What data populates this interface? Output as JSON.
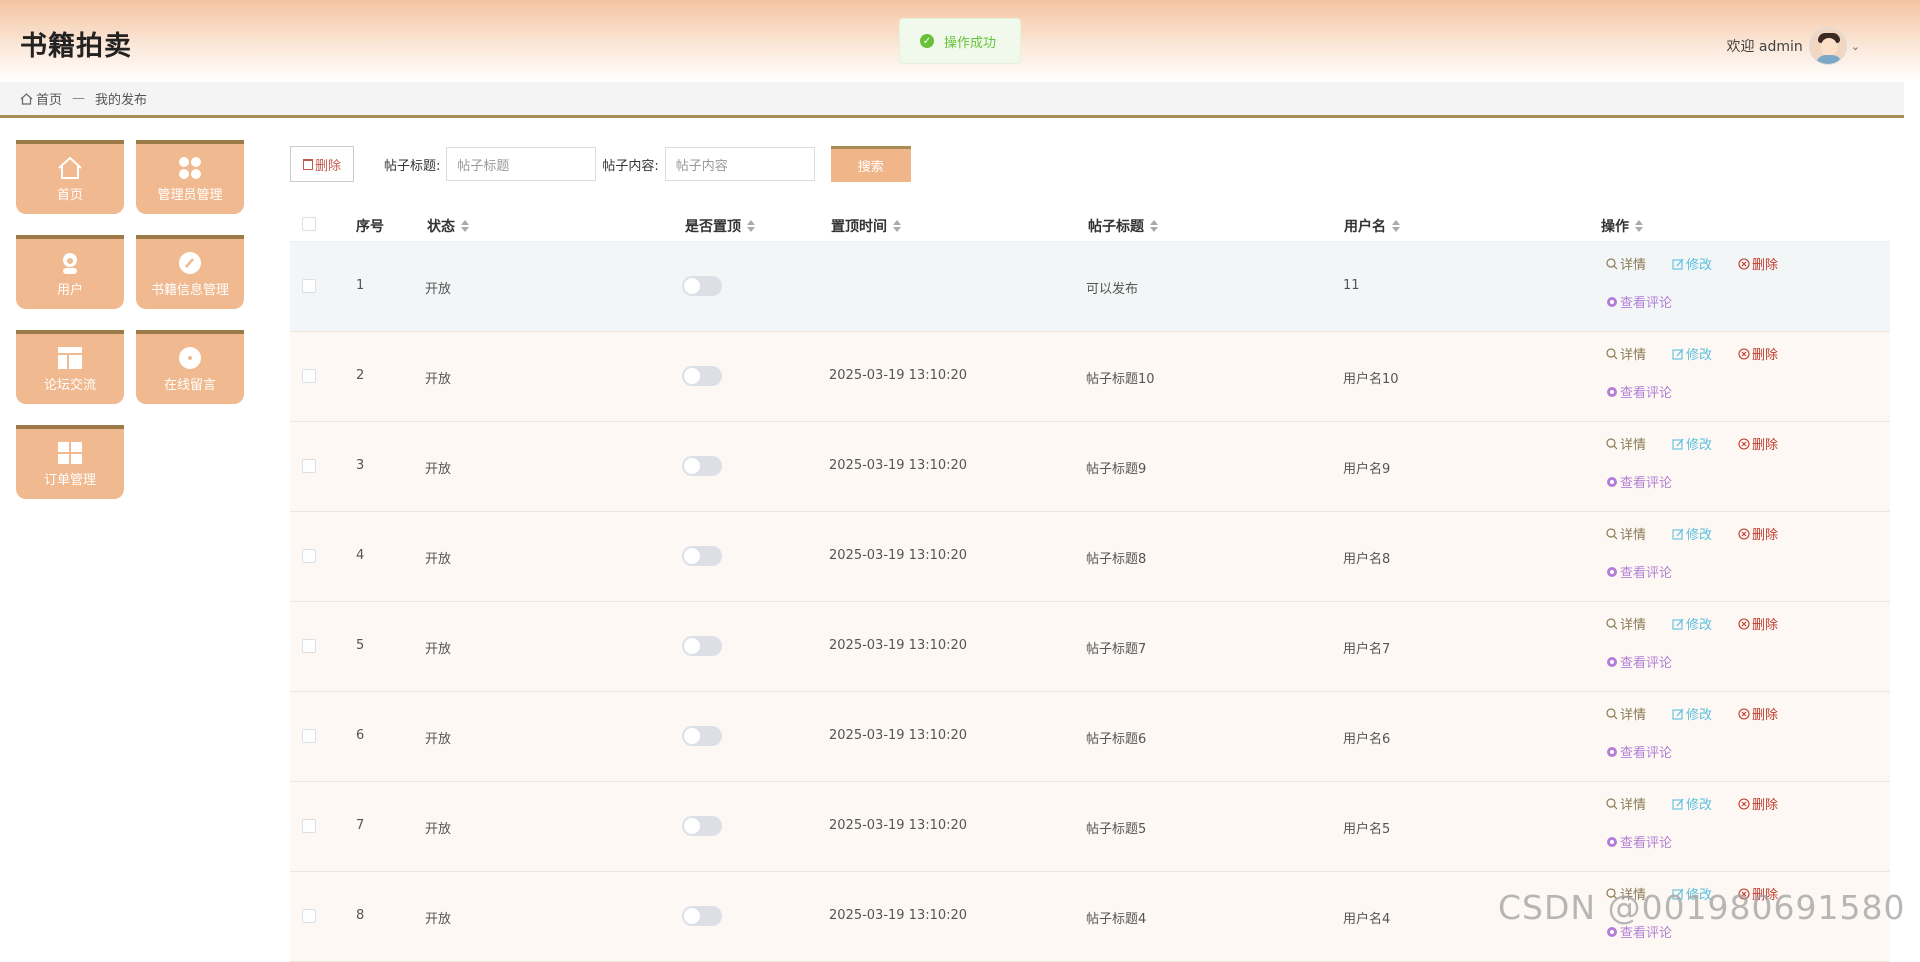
{
  "header": {
    "title": "书籍拍卖",
    "welcome": "欢迎 admin"
  },
  "toast": {
    "text": "操作成功"
  },
  "breadcrumb": {
    "home": "首页",
    "separator": "—",
    "current": "我的发布"
  },
  "sidebar": {
    "items": [
      {
        "label": "首页",
        "icon": "home-icon"
      },
      {
        "label": "管理员管理",
        "icon": "grid-dots-icon"
      },
      {
        "label": "用户",
        "icon": "user-icon"
      },
      {
        "label": "书籍信息管理",
        "icon": "pen-icon"
      },
      {
        "label": "论坛交流",
        "icon": "layout-icon"
      },
      {
        "label": "在线留言",
        "icon": "disc-icon"
      },
      {
        "label": "订单管理",
        "icon": "apps-icon"
      }
    ]
  },
  "toolbar": {
    "delete_label": "删除",
    "title_label": "帖子标题:",
    "title_placeholder": "帖子标题",
    "content_label": "帖子内容:",
    "content_placeholder": "帖子内容",
    "search_label": "搜索"
  },
  "table": {
    "columns": [
      "序号",
      "状态",
      "是否置顶",
      "置顶时间",
      "帖子标题",
      "用户名",
      "操作"
    ],
    "ops": {
      "detail": "详情",
      "edit": "修改",
      "delete": "删除",
      "comments": "查看评论"
    },
    "rows": [
      {
        "index": "1",
        "status": "开放",
        "pinned": false,
        "pin_time": "",
        "title": "可以发布",
        "user": "11"
      },
      {
        "index": "2",
        "status": "开放",
        "pinned": false,
        "pin_time": "2025-03-19 13:10:20",
        "title": "帖子标题10",
        "user": "用户名10"
      },
      {
        "index": "3",
        "status": "开放",
        "pinned": false,
        "pin_time": "2025-03-19 13:10:20",
        "title": "帖子标题9",
        "user": "用户名9"
      },
      {
        "index": "4",
        "status": "开放",
        "pinned": false,
        "pin_time": "2025-03-19 13:10:20",
        "title": "帖子标题8",
        "user": "用户名8"
      },
      {
        "index": "5",
        "status": "开放",
        "pinned": false,
        "pin_time": "2025-03-19 13:10:20",
        "title": "帖子标题7",
        "user": "用户名7"
      },
      {
        "index": "6",
        "status": "开放",
        "pinned": false,
        "pin_time": "2025-03-19 13:10:20",
        "title": "帖子标题6",
        "user": "用户名6"
      },
      {
        "index": "7",
        "status": "开放",
        "pinned": false,
        "pin_time": "2025-03-19 13:10:20",
        "title": "帖子标题5",
        "user": "用户名5"
      },
      {
        "index": "8",
        "status": "开放",
        "pinned": false,
        "pin_time": "2025-03-19 13:10:20",
        "title": "帖子标题4",
        "user": "用户名4"
      }
    ]
  },
  "watermark": "CSDN @001980691580"
}
